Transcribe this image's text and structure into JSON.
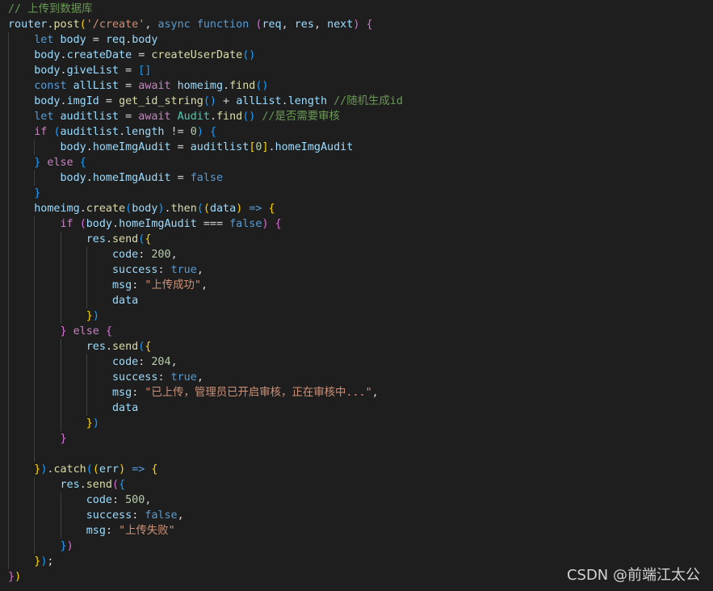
{
  "editor": {
    "lines": [
      [
        {
          "t": "// 上传到数据库",
          "c": "comment"
        }
      ],
      [
        {
          "t": "router",
          "c": "var"
        },
        {
          "t": ".",
          "c": "plain"
        },
        {
          "t": "post",
          "c": "fn"
        },
        {
          "t": "(",
          "c": "b1"
        },
        {
          "t": "'/create'",
          "c": "string"
        },
        {
          "t": ", ",
          "c": "plain"
        },
        {
          "t": "async",
          "c": "keyword"
        },
        {
          "t": " ",
          "c": "plain"
        },
        {
          "t": "function",
          "c": "keyword"
        },
        {
          "t": " ",
          "c": "plain"
        },
        {
          "t": "(",
          "c": "b2"
        },
        {
          "t": "req",
          "c": "var"
        },
        {
          "t": ", ",
          "c": "plain"
        },
        {
          "t": "res",
          "c": "var"
        },
        {
          "t": ", ",
          "c": "plain"
        },
        {
          "t": "next",
          "c": "var"
        },
        {
          "t": ")",
          "c": "b2"
        },
        {
          "t": " ",
          "c": "plain"
        },
        {
          "t": "{",
          "c": "b2"
        }
      ],
      [
        {
          "t": "    ",
          "c": "plain"
        },
        {
          "t": "let",
          "c": "keyword"
        },
        {
          "t": " ",
          "c": "plain"
        },
        {
          "t": "body",
          "c": "var"
        },
        {
          "t": " = ",
          "c": "plain"
        },
        {
          "t": "req",
          "c": "var"
        },
        {
          "t": ".",
          "c": "plain"
        },
        {
          "t": "body",
          "c": "var"
        }
      ],
      [
        {
          "t": "    ",
          "c": "plain"
        },
        {
          "t": "body",
          "c": "var"
        },
        {
          "t": ".",
          "c": "plain"
        },
        {
          "t": "createDate",
          "c": "var"
        },
        {
          "t": " = ",
          "c": "plain"
        },
        {
          "t": "createUserDate",
          "c": "fn"
        },
        {
          "t": "()",
          "c": "b3"
        }
      ],
      [
        {
          "t": "    ",
          "c": "plain"
        },
        {
          "t": "body",
          "c": "var"
        },
        {
          "t": ".",
          "c": "plain"
        },
        {
          "t": "giveList",
          "c": "var"
        },
        {
          "t": " = ",
          "c": "plain"
        },
        {
          "t": "[]",
          "c": "b3"
        }
      ],
      [
        {
          "t": "    ",
          "c": "plain"
        },
        {
          "t": "const",
          "c": "keyword"
        },
        {
          "t": " ",
          "c": "plain"
        },
        {
          "t": "allList",
          "c": "var"
        },
        {
          "t": " = ",
          "c": "plain"
        },
        {
          "t": "await",
          "c": "control"
        },
        {
          "t": " ",
          "c": "plain"
        },
        {
          "t": "homeimg",
          "c": "var"
        },
        {
          "t": ".",
          "c": "plain"
        },
        {
          "t": "find",
          "c": "fn"
        },
        {
          "t": "()",
          "c": "b3"
        }
      ],
      [
        {
          "t": "    ",
          "c": "plain"
        },
        {
          "t": "body",
          "c": "var"
        },
        {
          "t": ".",
          "c": "plain"
        },
        {
          "t": "imgId",
          "c": "var"
        },
        {
          "t": " = ",
          "c": "plain"
        },
        {
          "t": "get_id_string",
          "c": "fn"
        },
        {
          "t": "()",
          "c": "b3"
        },
        {
          "t": " + ",
          "c": "plain"
        },
        {
          "t": "allList",
          "c": "var"
        },
        {
          "t": ".",
          "c": "plain"
        },
        {
          "t": "length",
          "c": "var"
        },
        {
          "t": " ",
          "c": "plain"
        },
        {
          "t": "//随机生成id",
          "c": "comment"
        }
      ],
      [
        {
          "t": "    ",
          "c": "plain"
        },
        {
          "t": "let",
          "c": "keyword"
        },
        {
          "t": " ",
          "c": "plain"
        },
        {
          "t": "auditlist",
          "c": "var"
        },
        {
          "t": " = ",
          "c": "plain"
        },
        {
          "t": "await",
          "c": "control"
        },
        {
          "t": " ",
          "c": "plain"
        },
        {
          "t": "Audit",
          "c": "class"
        },
        {
          "t": ".",
          "c": "plain"
        },
        {
          "t": "find",
          "c": "fn"
        },
        {
          "t": "()",
          "c": "b3"
        },
        {
          "t": " ",
          "c": "plain"
        },
        {
          "t": "//是否需要审核",
          "c": "comment"
        }
      ],
      [
        {
          "t": "    ",
          "c": "plain"
        },
        {
          "t": "if",
          "c": "control"
        },
        {
          "t": " ",
          "c": "plain"
        },
        {
          "t": "(",
          "c": "b3"
        },
        {
          "t": "auditlist",
          "c": "var"
        },
        {
          "t": ".",
          "c": "plain"
        },
        {
          "t": "length",
          "c": "var"
        },
        {
          "t": " != ",
          "c": "plain"
        },
        {
          "t": "0",
          "c": "number"
        },
        {
          "t": ")",
          "c": "b3"
        },
        {
          "t": " ",
          "c": "plain"
        },
        {
          "t": "{",
          "c": "b3"
        }
      ],
      [
        {
          "t": "        ",
          "c": "plain"
        },
        {
          "t": "body",
          "c": "var"
        },
        {
          "t": ".",
          "c": "plain"
        },
        {
          "t": "homeImgAudit",
          "c": "var"
        },
        {
          "t": " = ",
          "c": "plain"
        },
        {
          "t": "auditlist",
          "c": "var"
        },
        {
          "t": "[",
          "c": "b1"
        },
        {
          "t": "0",
          "c": "number"
        },
        {
          "t": "]",
          "c": "b1"
        },
        {
          "t": ".",
          "c": "plain"
        },
        {
          "t": "homeImgAudit",
          "c": "var"
        }
      ],
      [
        {
          "t": "    ",
          "c": "plain"
        },
        {
          "t": "}",
          "c": "b3"
        },
        {
          "t": " ",
          "c": "plain"
        },
        {
          "t": "else",
          "c": "control"
        },
        {
          "t": " ",
          "c": "plain"
        },
        {
          "t": "{",
          "c": "b3"
        }
      ],
      [
        {
          "t": "        ",
          "c": "plain"
        },
        {
          "t": "body",
          "c": "var"
        },
        {
          "t": ".",
          "c": "plain"
        },
        {
          "t": "homeImgAudit",
          "c": "var"
        },
        {
          "t": " = ",
          "c": "plain"
        },
        {
          "t": "false",
          "c": "keyword"
        }
      ],
      [
        {
          "t": "    ",
          "c": "plain"
        },
        {
          "t": "}",
          "c": "b3"
        }
      ],
      [
        {
          "t": "    ",
          "c": "plain"
        },
        {
          "t": "homeimg",
          "c": "var"
        },
        {
          "t": ".",
          "c": "plain"
        },
        {
          "t": "create",
          "c": "fn"
        },
        {
          "t": "(",
          "c": "b3"
        },
        {
          "t": "body",
          "c": "var"
        },
        {
          "t": ")",
          "c": "b3"
        },
        {
          "t": ".",
          "c": "plain"
        },
        {
          "t": "then",
          "c": "fn"
        },
        {
          "t": "(",
          "c": "b3"
        },
        {
          "t": "(",
          "c": "b1"
        },
        {
          "t": "data",
          "c": "var"
        },
        {
          "t": ")",
          "c": "b1"
        },
        {
          "t": " ",
          "c": "plain"
        },
        {
          "t": "=>",
          "c": "keyword"
        },
        {
          "t": " ",
          "c": "plain"
        },
        {
          "t": "{",
          "c": "b1"
        }
      ],
      [
        {
          "t": "        ",
          "c": "plain"
        },
        {
          "t": "if",
          "c": "control"
        },
        {
          "t": " ",
          "c": "plain"
        },
        {
          "t": "(",
          "c": "b2"
        },
        {
          "t": "body",
          "c": "var"
        },
        {
          "t": ".",
          "c": "plain"
        },
        {
          "t": "homeImgAudit",
          "c": "var"
        },
        {
          "t": " === ",
          "c": "plain"
        },
        {
          "t": "false",
          "c": "keyword"
        },
        {
          "t": ")",
          "c": "b2"
        },
        {
          "t": " ",
          "c": "plain"
        },
        {
          "t": "{",
          "c": "b2"
        }
      ],
      [
        {
          "t": "            ",
          "c": "plain"
        },
        {
          "t": "res",
          "c": "var"
        },
        {
          "t": ".",
          "c": "plain"
        },
        {
          "t": "send",
          "c": "fn"
        },
        {
          "t": "(",
          "c": "b3"
        },
        {
          "t": "{",
          "c": "b1"
        }
      ],
      [
        {
          "t": "                ",
          "c": "plain"
        },
        {
          "t": "code",
          "c": "key"
        },
        {
          "t": ": ",
          "c": "plain"
        },
        {
          "t": "200",
          "c": "number"
        },
        {
          "t": ",",
          "c": "plain"
        }
      ],
      [
        {
          "t": "                ",
          "c": "plain"
        },
        {
          "t": "success",
          "c": "key"
        },
        {
          "t": ": ",
          "c": "plain"
        },
        {
          "t": "true",
          "c": "keyword"
        },
        {
          "t": ",",
          "c": "plain"
        }
      ],
      [
        {
          "t": "                ",
          "c": "plain"
        },
        {
          "t": "msg",
          "c": "key"
        },
        {
          "t": ": ",
          "c": "plain"
        },
        {
          "t": "\"上传成功\"",
          "c": "string"
        },
        {
          "t": ",",
          "c": "plain"
        }
      ],
      [
        {
          "t": "                ",
          "c": "plain"
        },
        {
          "t": "data",
          "c": "var"
        }
      ],
      [
        {
          "t": "            ",
          "c": "plain"
        },
        {
          "t": "}",
          "c": "b1"
        },
        {
          "t": ")",
          "c": "b3"
        }
      ],
      [
        {
          "t": "        ",
          "c": "plain"
        },
        {
          "t": "}",
          "c": "b2"
        },
        {
          "t": " ",
          "c": "plain"
        },
        {
          "t": "else",
          "c": "control"
        },
        {
          "t": " ",
          "c": "plain"
        },
        {
          "t": "{",
          "c": "b2"
        }
      ],
      [
        {
          "t": "            ",
          "c": "plain"
        },
        {
          "t": "res",
          "c": "var"
        },
        {
          "t": ".",
          "c": "plain"
        },
        {
          "t": "send",
          "c": "fn"
        },
        {
          "t": "(",
          "c": "b3"
        },
        {
          "t": "{",
          "c": "b1"
        }
      ],
      [
        {
          "t": "                ",
          "c": "plain"
        },
        {
          "t": "code",
          "c": "key"
        },
        {
          "t": ": ",
          "c": "plain"
        },
        {
          "t": "204",
          "c": "number"
        },
        {
          "t": ",",
          "c": "plain"
        }
      ],
      [
        {
          "t": "                ",
          "c": "plain"
        },
        {
          "t": "success",
          "c": "key"
        },
        {
          "t": ": ",
          "c": "plain"
        },
        {
          "t": "true",
          "c": "keyword"
        },
        {
          "t": ",",
          "c": "plain"
        }
      ],
      [
        {
          "t": "                ",
          "c": "plain"
        },
        {
          "t": "msg",
          "c": "key"
        },
        {
          "t": ": ",
          "c": "plain"
        },
        {
          "t": "\"已上传，管理员已开启审核，正在审核中...\"",
          "c": "string"
        },
        {
          "t": ",",
          "c": "plain"
        }
      ],
      [
        {
          "t": "                ",
          "c": "plain"
        },
        {
          "t": "data",
          "c": "var"
        }
      ],
      [
        {
          "t": "            ",
          "c": "plain"
        },
        {
          "t": "}",
          "c": "b1"
        },
        {
          "t": ")",
          "c": "b3"
        }
      ],
      [
        {
          "t": "        ",
          "c": "plain"
        },
        {
          "t": "}",
          "c": "b2"
        }
      ],
      [
        {
          "t": "",
          "c": "plain"
        }
      ],
      [
        {
          "t": "    ",
          "c": "plain"
        },
        {
          "t": "}",
          "c": "b1"
        },
        {
          "t": ")",
          "c": "b3"
        },
        {
          "t": ".",
          "c": "plain"
        },
        {
          "t": "catch",
          "c": "fn"
        },
        {
          "t": "(",
          "c": "b3"
        },
        {
          "t": "(",
          "c": "b1"
        },
        {
          "t": "err",
          "c": "var"
        },
        {
          "t": ")",
          "c": "b1"
        },
        {
          "t": " ",
          "c": "plain"
        },
        {
          "t": "=>",
          "c": "keyword"
        },
        {
          "t": " ",
          "c": "plain"
        },
        {
          "t": "{",
          "c": "b1"
        }
      ],
      [
        {
          "t": "        ",
          "c": "plain"
        },
        {
          "t": "res",
          "c": "var"
        },
        {
          "t": ".",
          "c": "plain"
        },
        {
          "t": "send",
          "c": "fn"
        },
        {
          "t": "(",
          "c": "b2"
        },
        {
          "t": "{",
          "c": "b3"
        }
      ],
      [
        {
          "t": "            ",
          "c": "plain"
        },
        {
          "t": "code",
          "c": "key"
        },
        {
          "t": ": ",
          "c": "plain"
        },
        {
          "t": "500",
          "c": "number"
        },
        {
          "t": ",",
          "c": "plain"
        }
      ],
      [
        {
          "t": "            ",
          "c": "plain"
        },
        {
          "t": "success",
          "c": "key"
        },
        {
          "t": ": ",
          "c": "plain"
        },
        {
          "t": "false",
          "c": "keyword"
        },
        {
          "t": ",",
          "c": "plain"
        }
      ],
      [
        {
          "t": "            ",
          "c": "plain"
        },
        {
          "t": "msg",
          "c": "key"
        },
        {
          "t": ": ",
          "c": "plain"
        },
        {
          "t": "\"上传失败\"",
          "c": "string"
        }
      ],
      [
        {
          "t": "        ",
          "c": "plain"
        },
        {
          "t": "}",
          "c": "b3"
        },
        {
          "t": ")",
          "c": "b2"
        }
      ],
      [
        {
          "t": "    ",
          "c": "plain"
        },
        {
          "t": "}",
          "c": "b1"
        },
        {
          "t": ")",
          "c": "b3"
        },
        {
          "t": ";",
          "c": "plain"
        }
      ],
      [
        {
          "t": "}",
          "c": "b2"
        },
        {
          "t": ")",
          "c": "b1"
        }
      ]
    ]
  },
  "watermark": {
    "text": "CSDN @前端江太公"
  }
}
